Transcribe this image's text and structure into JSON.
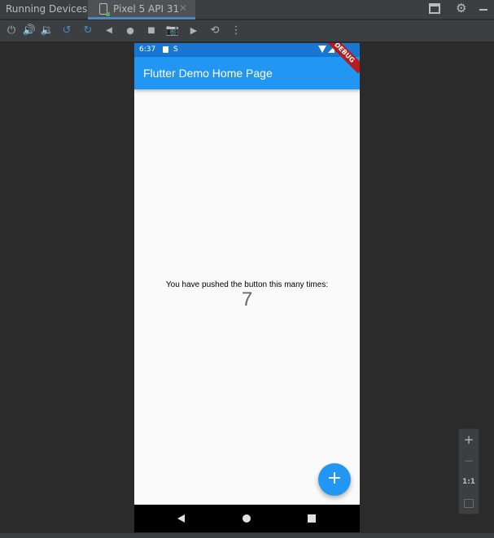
{
  "panel": {
    "title": "Running Devices:",
    "tab": {
      "label": "Pixel 5 API 31",
      "close": "✕"
    }
  },
  "toolbar": {
    "power": "⏻",
    "volume_up": "🔊",
    "volume_down": "🔉",
    "rotate_left": "↺",
    "rotate_right": "↻",
    "back": "◀",
    "home": "●",
    "overview": "■",
    "screenshot": "📷",
    "record": "▶",
    "undo": "⟲",
    "more": "⋮"
  },
  "device": {
    "status": {
      "time": "6:37",
      "s_icon": "S"
    },
    "banner": "DEBUG",
    "app_title": "Flutter Demo Home Page",
    "message": "You have pushed the button this many times:",
    "counter": "7",
    "fab": "+"
  },
  "zoom": {
    "plus": "+",
    "minus": "−",
    "one": "1:1"
  },
  "colors": {
    "appbar": "#2196f3",
    "statusbar": "#1976d2",
    "fab": "#2196f3",
    "accent": "#4a88c7"
  }
}
